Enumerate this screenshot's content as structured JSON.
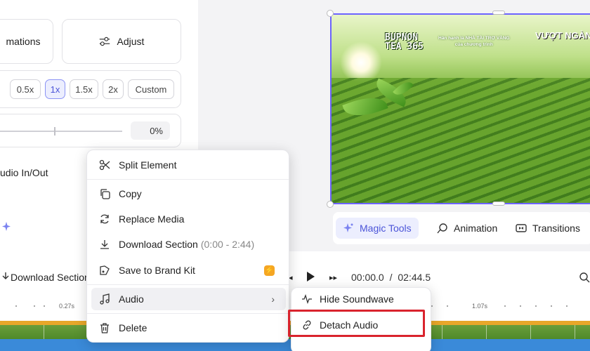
{
  "left_panel": {
    "animations_label": "mations",
    "adjust_label": "Adjust",
    "speed_options": [
      "0.5x",
      "1x",
      "1.5x",
      "2x",
      "Custom"
    ],
    "speed_selected": "1x",
    "percent_value": "0%",
    "audio_inout_label": "udio In/Out"
  },
  "preview": {
    "brand_line1": "BUPNON",
    "brand_line2": "TEA 365",
    "sponsor_line1": "Hân hạnh là NHÀ TÀI TRỢ VÀNG",
    "sponsor_line2": "của chương trình",
    "brand2": "VƯỢT NGÀN"
  },
  "tools": {
    "magic_tools": "Magic Tools",
    "animation": "Animation",
    "transitions": "Transitions"
  },
  "toolbar": {
    "download_section": "Download Section",
    "time_current": "00:00.0",
    "time_separator": "/",
    "time_total": "02:44.5"
  },
  "timeline": {
    "label_a": "0.27s",
    "label_b": "1.07s"
  },
  "context_menu": {
    "split_element": "Split Element",
    "copy": "Copy",
    "replace_media": "Replace Media",
    "download_section": "Download Section",
    "download_range": "(0:00 - 2:44)",
    "save_brand_kit": "Save to Brand Kit",
    "audio": "Audio",
    "delete": "Delete"
  },
  "audio_submenu": {
    "hide_soundwave": "Hide Soundwave",
    "detach_audio": "Detach Audio"
  },
  "colors": {
    "accent": "#6c63ff",
    "highlight": "#d9232d",
    "badge": "#f5a623"
  }
}
